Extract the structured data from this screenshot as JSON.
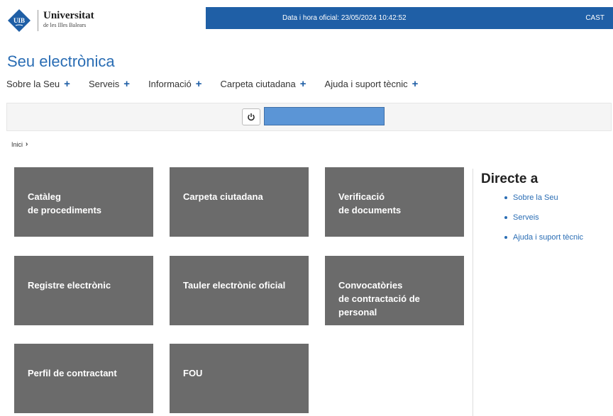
{
  "header": {
    "logo_text": "UIB",
    "university_name": "Universitat",
    "university_sub": "de les Illes Balears",
    "datetime_label": "Data i hora oficial: 23/05/2024  10:42:52",
    "language_link": "CAST",
    "topbar_color": "#1f5fa6"
  },
  "page_title": "Seu electrònica",
  "nav": {
    "items": [
      {
        "label": "Sobre la Seu",
        "icon": "plus-icon"
      },
      {
        "label": "Serveis",
        "icon": "plus-icon"
      },
      {
        "label": "Informació",
        "icon": "plus-icon"
      },
      {
        "label": "Carpeta ciutadana",
        "icon": "plus-icon"
      },
      {
        "label": "Ajuda i suport tècnic",
        "icon": "plus-icon"
      }
    ]
  },
  "login": {
    "power_icon": "power-icon",
    "user_field_value": ""
  },
  "breadcrumb": {
    "home": "Inici"
  },
  "tiles": [
    {
      "label": "Catàleg\nde procediments"
    },
    {
      "label": "Carpeta ciutadana"
    },
    {
      "label": "Verificació\nde documents"
    },
    {
      "label": "Registre electrònic"
    },
    {
      "label": "Tauler electrònic oficial"
    },
    {
      "label": "Convocatòries\nde contractació de\npersonal"
    },
    {
      "label": "Perfil de contractant"
    },
    {
      "label": "FOU"
    }
  ],
  "directe": {
    "title": "Directe a",
    "links": [
      "Sobre la Seu",
      "Serveis",
      "Ajuda i suport tècnic"
    ]
  },
  "colors": {
    "tile_bg": "#6b6b6b",
    "accent": "#2a6db4"
  }
}
